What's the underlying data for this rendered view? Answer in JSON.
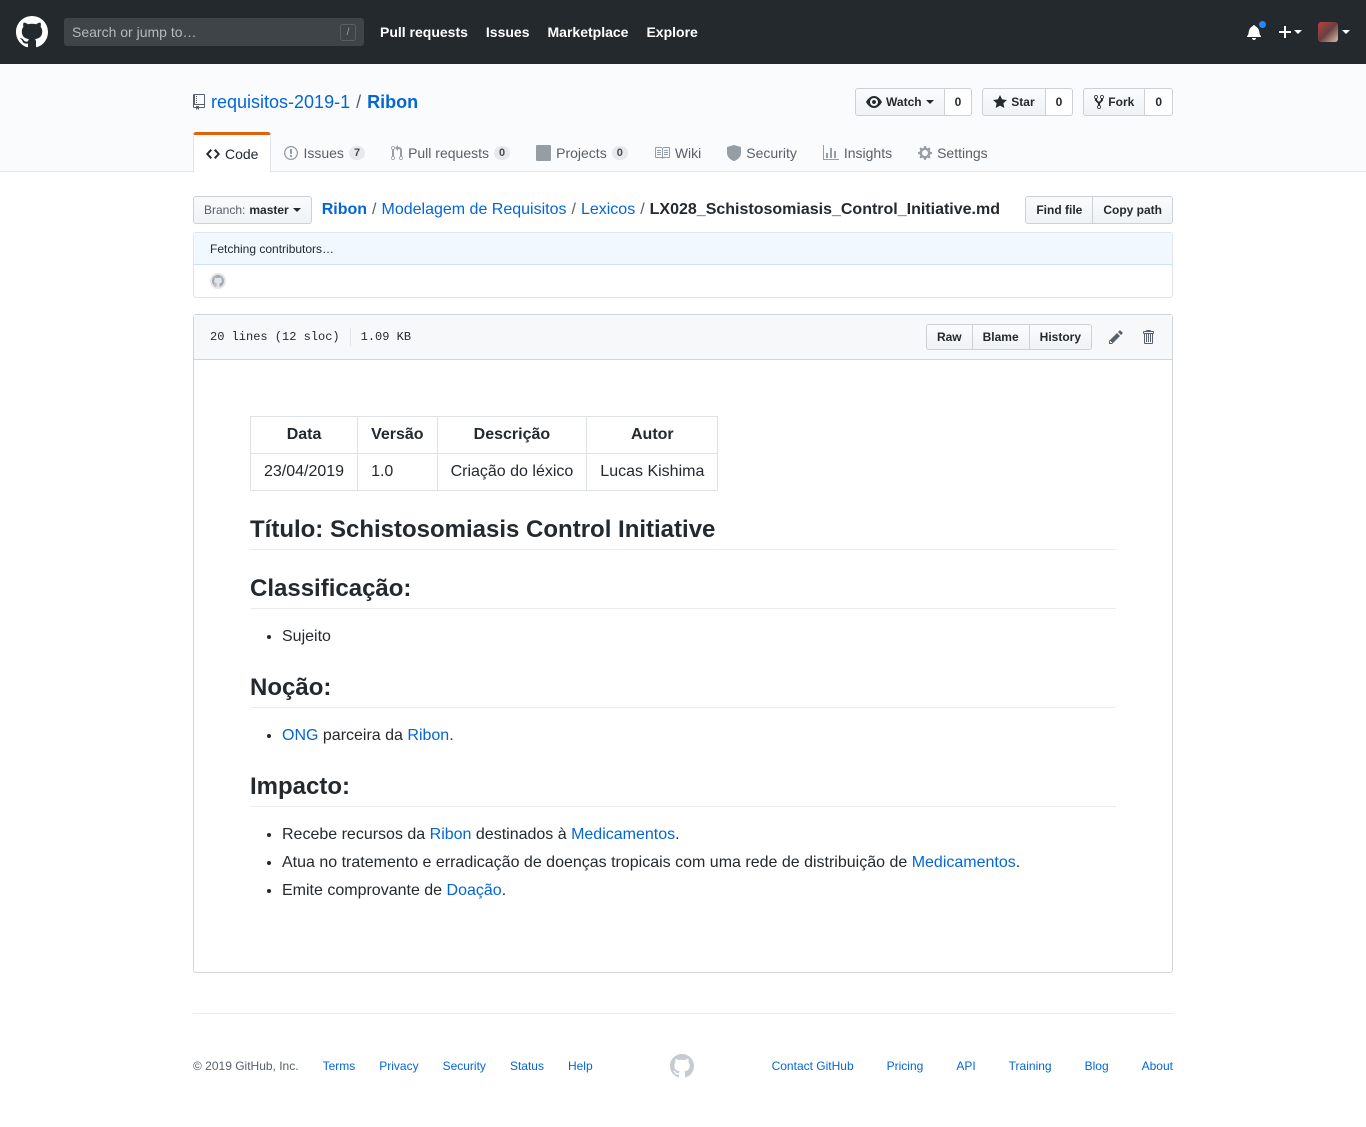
{
  "header": {
    "search_placeholder": "Search or jump to…",
    "search_hotkey": "/",
    "nav": [
      "Pull requests",
      "Issues",
      "Marketplace",
      "Explore"
    ]
  },
  "repo": {
    "owner": "requisitos-2019-1",
    "separator": "/",
    "name": "Ribon",
    "watch_label": "Watch",
    "watch_count": "0",
    "star_label": "Star",
    "star_count": "0",
    "fork_label": "Fork",
    "fork_count": "0"
  },
  "tabs": [
    {
      "label": "Code",
      "icon": "code-icon"
    },
    {
      "label": "Issues",
      "count": "7",
      "icon": "issue-icon"
    },
    {
      "label": "Pull requests",
      "count": "0",
      "icon": "pull-request-icon"
    },
    {
      "label": "Projects",
      "count": "0",
      "icon": "project-icon"
    },
    {
      "label": "Wiki",
      "icon": "book-icon"
    },
    {
      "label": "Security",
      "icon": "shield-icon"
    },
    {
      "label": "Insights",
      "icon": "graph-icon"
    },
    {
      "label": "Settings",
      "icon": "gear-icon"
    }
  ],
  "file_nav": {
    "branch_label": "Branch:",
    "branch": "master",
    "path": [
      "Ribon",
      "Modelagem de Requisitos",
      "Lexicos"
    ],
    "filename": "LX028_Schistosomiasis_Control_Initiative.md",
    "find_file": "Find file",
    "copy_path": "Copy path"
  },
  "commit": {
    "fetching": "Fetching contributors…"
  },
  "file": {
    "lines": "20 lines (12 sloc)",
    "size": "1.09 KB",
    "raw": "Raw",
    "blame": "Blame",
    "history": "History"
  },
  "markdown": {
    "table": {
      "headers": [
        "Data",
        "Versão",
        "Descrição",
        "Autor"
      ],
      "rows": [
        [
          "23/04/2019",
          "1.0",
          "Criação do léxico",
          "Lucas Kishima"
        ]
      ]
    },
    "title": "Título: Schistosomiasis Control Initiative",
    "classificacao_heading": "Classificação:",
    "classificacao_item": "Sujeito",
    "nocao_heading": "Noção:",
    "nocao": {
      "link1": "ONG",
      "text1": " parceira da ",
      "link2": "Ribon",
      "text2": "."
    },
    "impacto_heading": "Impacto:",
    "impacto": [
      {
        "t1": "Recebe recursos da ",
        "l1": "Ribon",
        "t2": " destinados à ",
        "l2": "Medicamentos",
        "t3": "."
      },
      {
        "t1": "Atua no tratemento e erradicação de doenças tropicais com uma rede de distribuição de ",
        "l1": "Medicamentos",
        "t2": "."
      },
      {
        "t1": "Emite comprovante de ",
        "l1": "Doação",
        "t2": "."
      }
    ]
  },
  "footer": {
    "copyright": "© 2019 GitHub, Inc.",
    "left_links": [
      "Terms",
      "Privacy",
      "Security",
      "Status",
      "Help"
    ],
    "right_links": [
      "Contact GitHub",
      "Pricing",
      "API",
      "Training",
      "Blog",
      "About"
    ]
  },
  "colors": {
    "header_bg": "#24292e",
    "link": "#0366d6",
    "tab_accent": "#e36209",
    "notification_dot": "#2188ff"
  }
}
